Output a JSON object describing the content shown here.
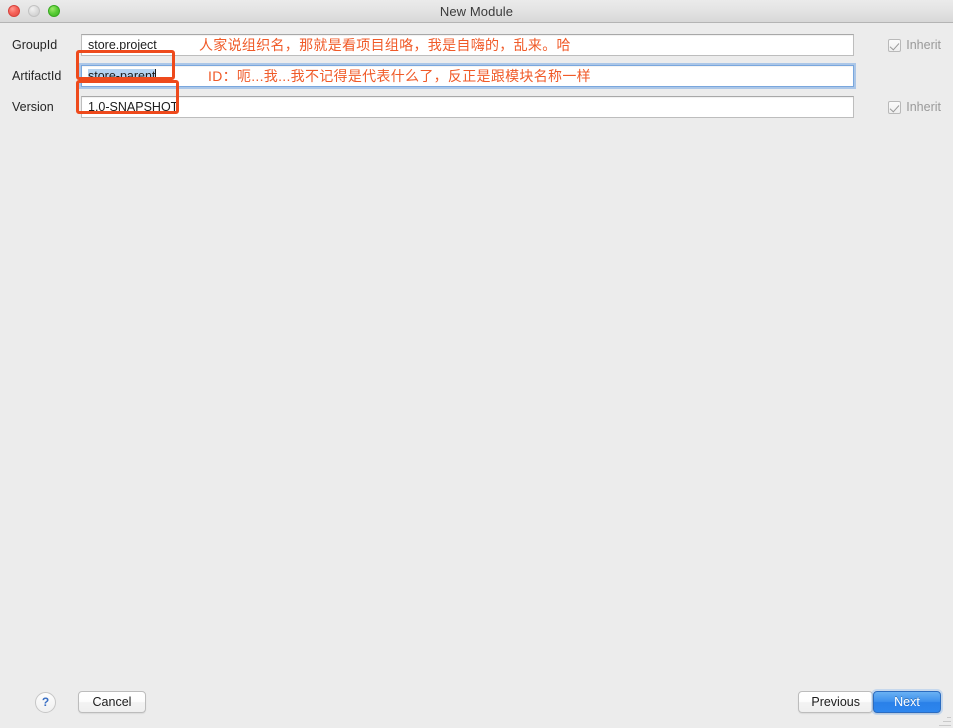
{
  "window": {
    "title": "New Module",
    "traffic_lights": {
      "close": "close-button",
      "minimize": "minimize-button",
      "maximize": "maximize-button"
    }
  },
  "colors": {
    "annotation": "#f05a28",
    "annotation_box": "#ee4a1c",
    "default_button": "#2a80e8",
    "selection": "#b5d3f0",
    "window_background": "#ececec"
  },
  "form": {
    "rows": [
      {
        "label": "GroupId",
        "value": "store.project",
        "placeholder": "",
        "focused": false,
        "selected": false,
        "inherit": {
          "label": "Inherit",
          "checked": true,
          "enabled": false
        },
        "annotation": "人家说组织名，那就是看项目组咯，我是自嗨的，乱来。哈",
        "highlighted": true
      },
      {
        "label": "ArtifactId",
        "value": "store-parent",
        "placeholder": "",
        "focused": true,
        "selected": true,
        "inherit": null,
        "annotation": "ID：呃...我...我不记得是代表什么了，反正是跟模块名称一样",
        "highlighted": true
      },
      {
        "label": "Version",
        "value": "1.0-SNAPSHOT",
        "placeholder": "",
        "focused": false,
        "selected": false,
        "inherit": {
          "label": "Inherit",
          "checked": true,
          "enabled": false
        },
        "annotation": "",
        "highlighted": false
      }
    ]
  },
  "footer": {
    "help_label": "?",
    "cancel_label": "Cancel",
    "previous_label": "Previous",
    "next_label": "Next"
  }
}
